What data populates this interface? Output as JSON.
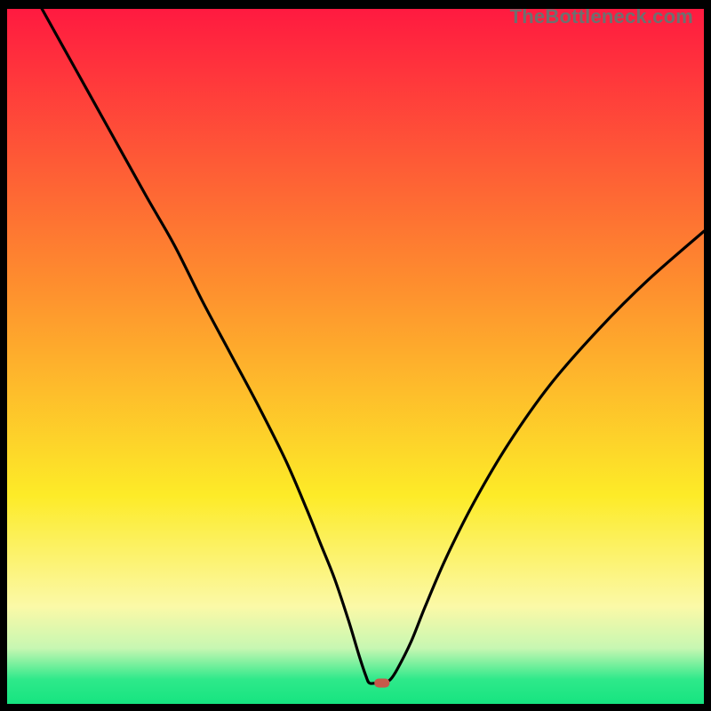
{
  "watermark": "TheBottleneck.com",
  "chart_data": {
    "type": "line",
    "title": "",
    "xlabel": "",
    "ylabel": "",
    "xlim": [
      0,
      100
    ],
    "ylim": [
      0,
      100
    ],
    "background_gradient": {
      "stops": [
        {
          "offset": 0.0,
          "color": "#ff1a40"
        },
        {
          "offset": 0.4,
          "color": "#fe8f2e"
        },
        {
          "offset": 0.7,
          "color": "#fdeb28"
        },
        {
          "offset": 0.86,
          "color": "#fbf9a7"
        },
        {
          "offset": 0.92,
          "color": "#c7f7b2"
        },
        {
          "offset": 0.965,
          "color": "#2ee98a"
        },
        {
          "offset": 1.0,
          "color": "#16e480"
        }
      ]
    },
    "series": [
      {
        "name": "bottleneck-curve",
        "color": "#000000",
        "x": [
          5,
          10,
          15,
          20,
          24,
          28,
          32,
          36,
          40,
          43,
          45,
          47,
          49,
          50.5,
          51.5,
          52,
          53,
          54,
          55,
          56,
          58,
          60,
          63,
          67,
          72,
          78,
          85,
          92,
          100
        ],
        "y": [
          100,
          91,
          82,
          73,
          66,
          58,
          50.5,
          43,
          35,
          28,
          23,
          18,
          12,
          7,
          4,
          3,
          3,
          3,
          3.5,
          5,
          9,
          14,
          21,
          29,
          37.5,
          46,
          54,
          61,
          68
        ]
      }
    ],
    "marker": {
      "name": "optimal-point",
      "x": 53.8,
      "y": 3.0,
      "width": 2.2,
      "height": 1.3,
      "color": "#c65a4a"
    },
    "grid": false,
    "legend": false
  }
}
